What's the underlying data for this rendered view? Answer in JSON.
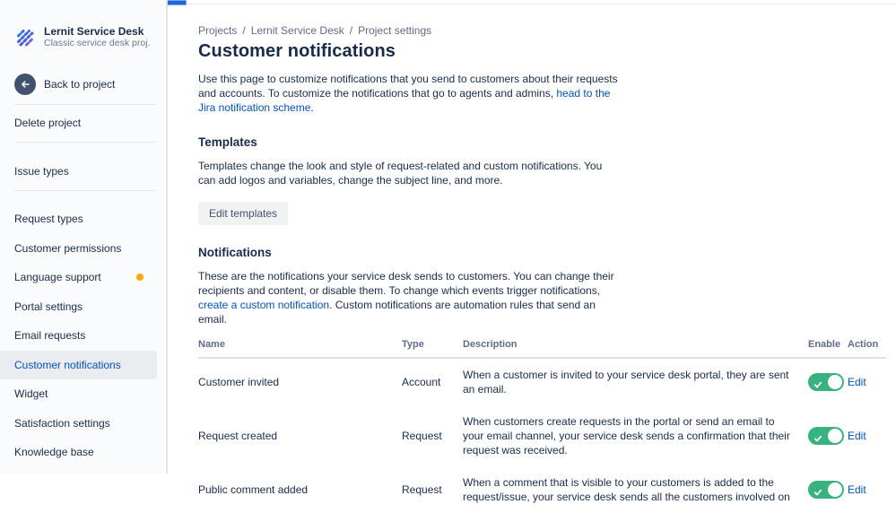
{
  "colors": {
    "accent_blue": "#0052CC",
    "toggle_on_green": "#36B37E",
    "selected_item_bg": "#EBECF0",
    "badge_yellow": "#FFAB00",
    "text_dark": "#172B4D",
    "text_gray": "#5E6C84"
  },
  "sidebar": {
    "project": {
      "name": "Lernit Service Desk",
      "subtitle": "Classic service desk proj...",
      "icon": "diagonal-stripes-avatar"
    },
    "back_label": "Back to project",
    "delete_label": "Delete project",
    "issue_types_label": "Issue types",
    "items": [
      {
        "label": "Request types",
        "selected": false,
        "badge": false
      },
      {
        "label": "Customer permissions",
        "selected": false,
        "badge": false
      },
      {
        "label": "Language support",
        "selected": false,
        "badge": true
      },
      {
        "label": "Portal settings",
        "selected": false,
        "badge": false
      },
      {
        "label": "Email requests",
        "selected": false,
        "badge": false
      },
      {
        "label": "Customer notifications",
        "selected": true,
        "badge": false
      },
      {
        "label": "Widget",
        "selected": false,
        "badge": false
      },
      {
        "label": "Satisfaction settings",
        "selected": false,
        "badge": false
      },
      {
        "label": "Knowledge base",
        "selected": false,
        "badge": false
      }
    ]
  },
  "main": {
    "breadcrumb": {
      "items": [
        "Projects",
        "Lernit Service Desk",
        "Project settings"
      ],
      "separator": "/"
    },
    "title": "Customer notifications",
    "intro": {
      "before": "Use this page to customize notifications that you send to customers about their requests and accounts. To customize the notifications that go to agents and admins, ",
      "link": "head to the Jira notification scheme",
      "after": "."
    },
    "templates": {
      "heading": "Templates",
      "body": "Templates change the look and style of request-related and custom notifications. You can add logos and variables, change the subject line, and more.",
      "button_label": "Edit templates"
    },
    "notifications": {
      "heading": "Notifications",
      "body_before": "These are the notifications your service desk sends to customers. You can change their recipients and content, or disable them. To change which events trigger notifications, ",
      "body_link": "create a custom notification",
      "body_after": ". Custom notifications are automation rules that send an email.",
      "table": {
        "headers": [
          "Name",
          "Type",
          "Description",
          "Enable",
          "Action"
        ],
        "rows": [
          {
            "name": "Customer invited",
            "type": "Account",
            "description": "When a customer is invited to your service desk portal, they are sent an email.",
            "enabled": true,
            "action": "Edit"
          },
          {
            "name": "Request created",
            "type": "Request",
            "description": "When customers create requests in the portal or send an email to your email channel, your service desk sends a confirmation that their request was received.",
            "enabled": true,
            "action": "Edit"
          },
          {
            "name": "Public comment added",
            "type": "Request",
            "description": "When a comment that is visible to your customers is added to the request/issue, your service desk sends all the customers involved on",
            "enabled": true,
            "action": "Edit"
          }
        ]
      }
    }
  }
}
